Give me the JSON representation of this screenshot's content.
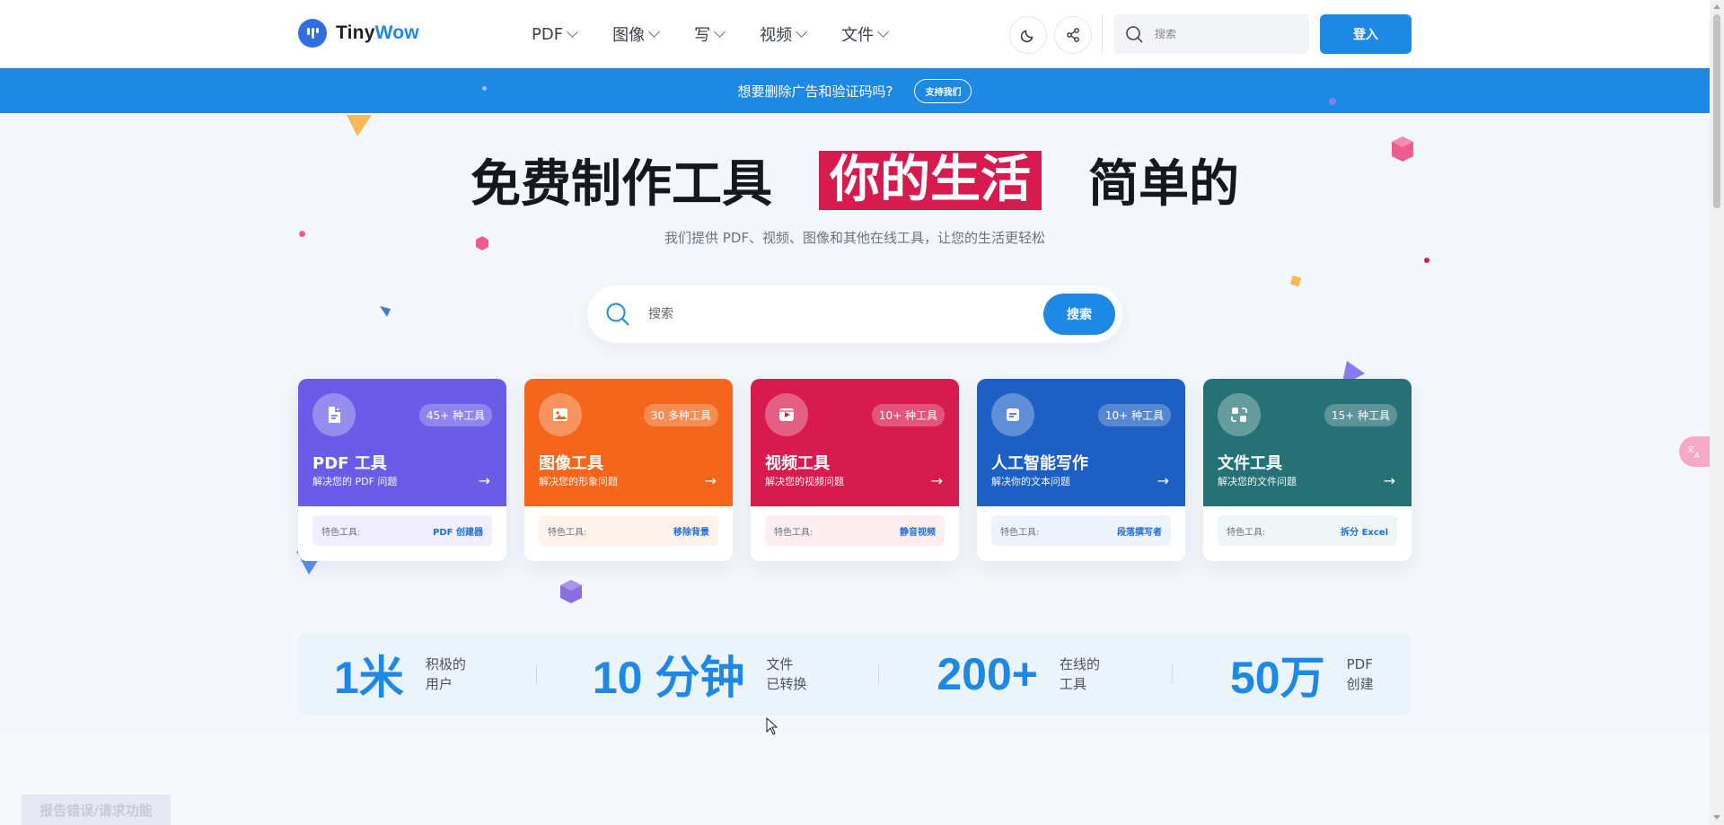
{
  "header": {
    "logo": {
      "part1": "Tiny",
      "part2": "Wow"
    },
    "nav": [
      {
        "label": "PDF"
      },
      {
        "label": "图像"
      },
      {
        "label": "写"
      },
      {
        "label": "视频"
      },
      {
        "label": "文件"
      }
    ],
    "search_placeholder": "搜索",
    "login_label": "登入"
  },
  "banner": {
    "text": "想要删除广告和验证码吗?",
    "button_label": "支持我们"
  },
  "hero": {
    "title_before": "免费制作工具",
    "title_highlight": "你的生活",
    "title_after": "简单的",
    "subtitle": "我们提供 PDF、视频、图像和其他在线工具，让您的生活更轻松",
    "search_placeholder": "搜索",
    "search_button": "搜索"
  },
  "cards": [
    {
      "title": "PDF 工具",
      "desc": "解决您的 PDF 问题",
      "badge": "45+ 种工具",
      "featured_label": "特色工具:",
      "featured_tool": "PDF 创建器",
      "color": "#6b5ce7",
      "feat_bg": "#f1efff",
      "icon": "pdf-file-icon"
    },
    {
      "title": "图像工具",
      "desc": "解决您的形象问题",
      "badge": "30 多种工具",
      "featured_label": "特色工具:",
      "featured_tool": "移除背景",
      "color": "#f4661b",
      "feat_bg": "#fff3ec",
      "icon": "image-icon"
    },
    {
      "title": "视频工具",
      "desc": "解决您的视频问题",
      "badge": "10+ 种工具",
      "featured_label": "特色工具:",
      "featured_tool": "静音视频",
      "color": "#d81b4f",
      "feat_bg": "#fdeef2",
      "icon": "video-icon"
    },
    {
      "title": "人工智能写作",
      "desc": "解决你的文本问题",
      "badge": "10+ 种工具",
      "featured_label": "特色工具:",
      "featured_tool": "段落撰写者",
      "color": "#1e5fc4",
      "feat_bg": "#eef3fc",
      "icon": "document-icon"
    },
    {
      "title": "文件工具",
      "desc": "解决您的文件问题",
      "badge": "15+ 种工具",
      "featured_label": "特色工具:",
      "featured_tool": "拆分 Excel",
      "color": "#267176",
      "feat_bg": "#eef6f6",
      "icon": "file-convert-icon"
    }
  ],
  "stats": [
    {
      "number": "1米",
      "label_line1": "积极的",
      "label_line2": "用户"
    },
    {
      "number": "10 分钟",
      "label_line1": "文件",
      "label_line2": "已转换"
    },
    {
      "number": "200+",
      "label_line1": "在线的",
      "label_line2": "工具"
    },
    {
      "number": "50万",
      "label_line1": "PDF",
      "label_line2": "创建"
    }
  ],
  "report_button": "报告错误/请求功能",
  "colors": {
    "accent": "#1e88e5",
    "highlight": "#d81b4f"
  }
}
